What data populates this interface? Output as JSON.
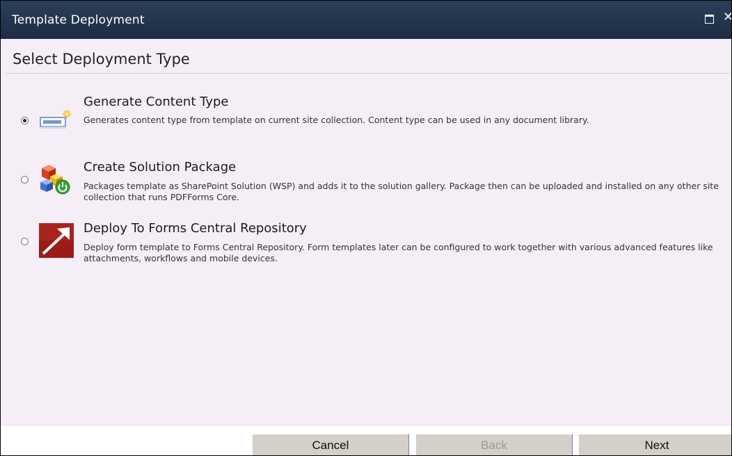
{
  "window": {
    "title": "Template Deployment",
    "maximize_icon": "maximize-icon",
    "close_icon": "close-icon",
    "close_glyph": "✕"
  },
  "page": {
    "heading": "Select Deployment Type"
  },
  "options": [
    {
      "title": "Generate Content Type",
      "description": "Generates content type from template on current site collection. Content type can be used in any document library.",
      "selected": true,
      "icon": "content-type-icon"
    },
    {
      "title": "Create Solution Package",
      "description": "Packages template as SharePoint Solution (WSP) and adds it to the solution gallery. Package then can be uploaded and installed on any other site collection that runs PDFForms Core.",
      "selected": false,
      "icon": "solution-package-icon"
    },
    {
      "title": "Deploy To Forms Central Repository",
      "description": "Deploy form template to Forms Central Repository. Form templates later can be configured to work together with various advanced features like attachments, workflows and mobile devices.",
      "selected": false,
      "icon": "forms-repository-icon"
    }
  ],
  "footer": {
    "cancel_label": "Cancel",
    "back_label": "Back",
    "next_label": "Next"
  },
  "colors": {
    "titlebar": "#1f3148",
    "content_bg": "#f6eef6",
    "repository_icon": "#9b1c17"
  }
}
